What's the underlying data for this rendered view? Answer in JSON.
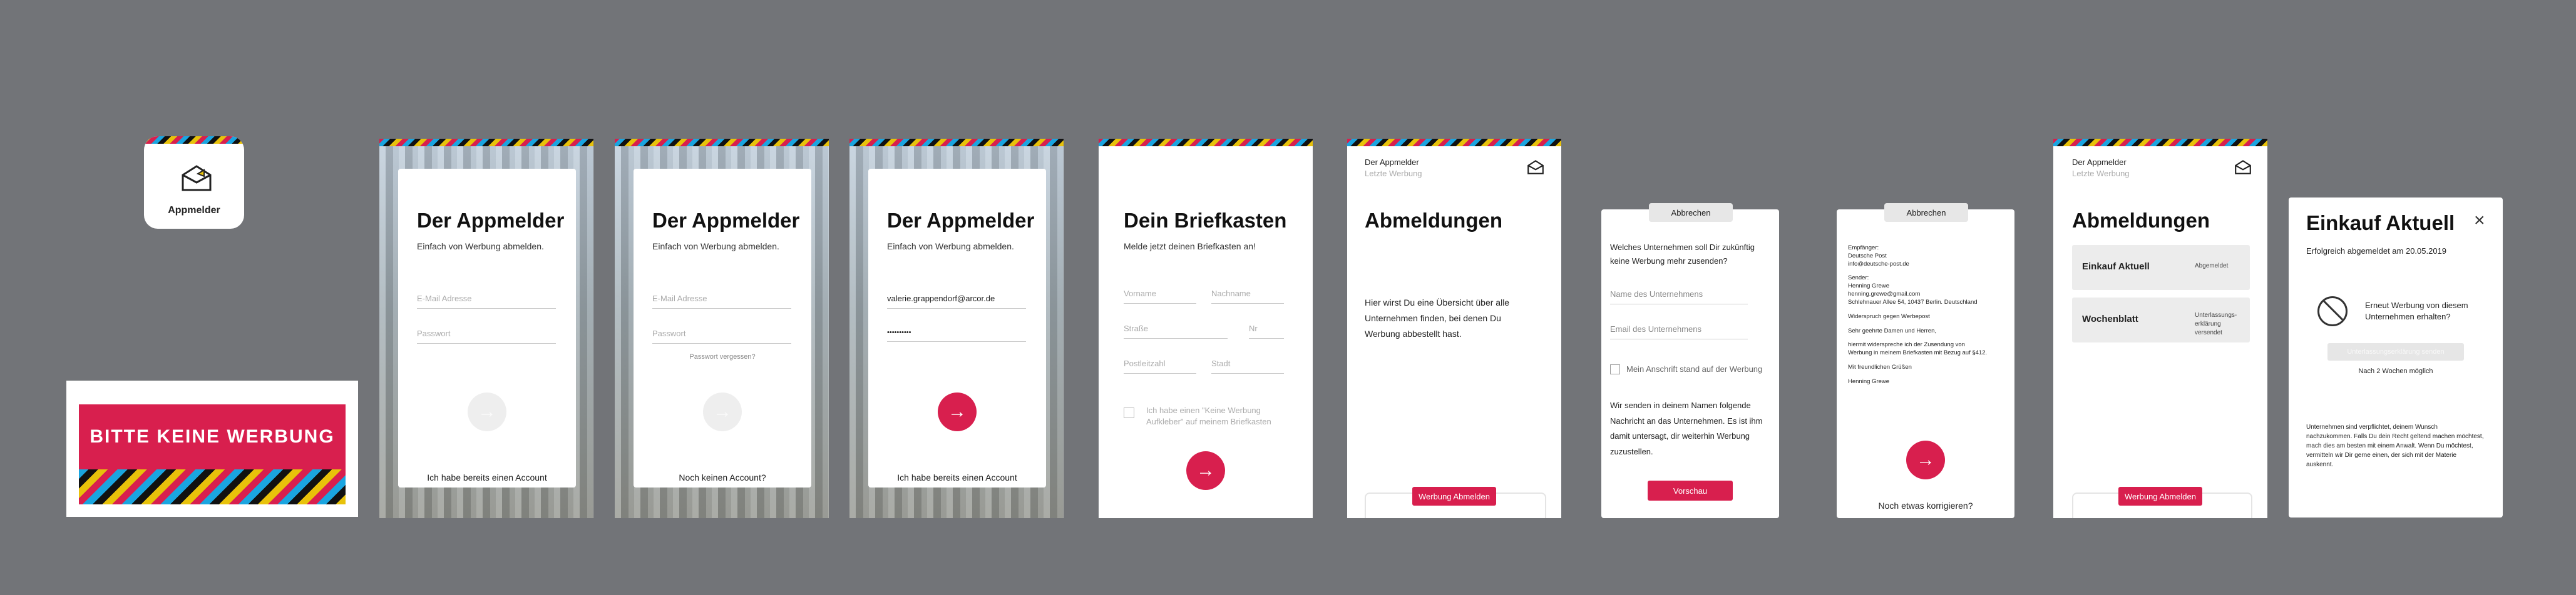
{
  "colors": {
    "background": "#727478",
    "accent": "#d81f4e",
    "card": "#ffffff",
    "stripe_colors": [
      "#e8c20a",
      "#111111",
      "#1aa5e0",
      "#d81f4e"
    ]
  },
  "app_icon": {
    "label": "Appmelder",
    "icon": "mailbox-icon"
  },
  "sticker": {
    "text": "BITTE KEINE WERBUNG"
  },
  "login1": {
    "title": "Der Appmelder",
    "subtitle": "Einfach von Werbung abmelden.",
    "email_placeholder": "E-Mail Adresse",
    "password_placeholder": "Passwort",
    "link": "Ich habe bereits einen Account"
  },
  "login2": {
    "title": "Der Appmelder",
    "subtitle": "Einfach von Werbung abmelden.",
    "email_placeholder": "E-Mail Adresse",
    "password_placeholder": "Passwort",
    "forgot": "Passwort vergessen?",
    "link": "Noch keinen Account?"
  },
  "login3": {
    "title": "Der Appmelder",
    "subtitle": "Einfach von Werbung abmelden.",
    "email_value": "valerie.grappendorf@arcor.de",
    "password_value": "••••••••••",
    "link": "Ich habe bereits einen Account"
  },
  "briefkasten": {
    "title": "Dein Briefkasten",
    "subtitle": "Melde jetzt deinen Briefkasten an!",
    "vorname": "Vorname",
    "nachname": "Nachname",
    "strasse": "Straße",
    "nr": "Nr",
    "plz": "Postleitzahl",
    "stadt": "Stadt",
    "checkbox_label": "Ich habe einen \"Keine Werbung Aufkleber\" auf meinem Briefkasten"
  },
  "abmeldungen_empty": {
    "brand": "Der Appmelder",
    "brand_sub": "Letzte Werbung",
    "title": "Abmeldungen",
    "text": "Hier wirst Du eine Übersicht über alle Unternehmen finden, bei denen Du Werbung abbestellt hast.",
    "button": "Werbung Abmelden"
  },
  "form_modal": {
    "cancel": "Abbrechen",
    "question": "Welches Unternehmen soll Dir zukünftig keine Werbung mehr zusenden?",
    "company_placeholder": "Name des Unternehmens",
    "email_placeholder": "Email des Unternehmens",
    "checkbox_label": "Mein Anschrift stand auf der Werbung",
    "info": "Wir senden in deinem Namen folgende Nachricht an das Unternehmen. Es ist ihm damit untersagt, dir weiterhin Werbung zuzustellen.",
    "button": "Vorschau"
  },
  "letter_modal": {
    "cancel": "Abbrechen",
    "lines": [
      "Empfänger:",
      "Deutsche Post",
      "info@deutsche-post.de",
      "",
      "Sender:",
      "Henning Grewe",
      "henning.grewe@gmail.com",
      "Schlehnauer Allee 54, 10437 Berlin. Deutschland",
      "",
      "Widerspruch gegen Werbepost",
      "",
      "Sehr geehrte Damen und Herren,",
      "",
      "hiermit widerspreche ich der Zusendung von",
      "Werbung in meinem Briefkasten mit Bezug auf §412.",
      "",
      "Mit freundlichen Grüßen",
      "",
      "Henning Grewe"
    ],
    "link": "Noch etwas korrigieren?"
  },
  "abmeldungen_list": {
    "brand": "Der Appmelder",
    "brand_sub": "Letzte Werbung",
    "title": "Abmeldungen",
    "items": [
      {
        "name": "Einkauf Aktuell",
        "status": "Abgemeldet"
      },
      {
        "name": "Wochenblatt",
        "status": "Unterlassungs-erklärung versendet"
      }
    ],
    "button": "Werbung Abmelden"
  },
  "detail": {
    "title": "Einkauf Aktuell",
    "status": "Erfolgreich abgemeldet am 20.05.2019",
    "question": "Erneut Werbung von diesem Unternehmen erhalten?",
    "button": "Unterlassungserklärung senden",
    "hint": "Nach 2 Wochen möglich",
    "info": "Unternehmen sind verpflichtet, deinem Wunsch nachzukommen. Falls Du dein Recht geltend machen möchtest, mach dies am besten mit einem Anwalt. Wenn Du möchtest, vermitteln wir Dir gerne einen, der sich mit der Materie auskennt."
  }
}
